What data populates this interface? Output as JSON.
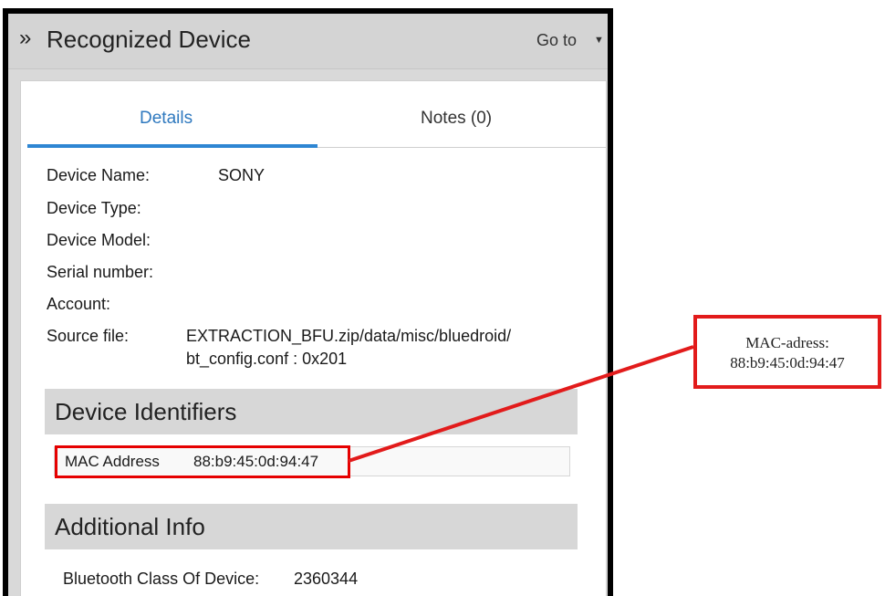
{
  "header": {
    "title": "Recognized Device",
    "goto_label": "Go to",
    "expand_icon": "double-chevron-right-icon",
    "dropdown_icon": "caret-down-icon"
  },
  "tabs": [
    {
      "label": "Details",
      "active": true
    },
    {
      "label": "Notes (0)",
      "active": false
    }
  ],
  "details": [
    {
      "label": "Device Name:",
      "value": "SONY"
    },
    {
      "label": "Device Type:",
      "value": ""
    },
    {
      "label": "Device Model:",
      "value": ""
    },
    {
      "label": "Serial number:",
      "value": ""
    },
    {
      "label": "Account:",
      "value": ""
    },
    {
      "label": "Source file:",
      "value": "EXTRACTION_BFU.zip/data/misc/bluedroid/",
      "value2": "bt_config.conf : 0x201"
    }
  ],
  "sections": {
    "identifiers_title": "Device Identifiers",
    "additional_title": "Additional Info"
  },
  "identifiers": {
    "mac_label": "MAC Address",
    "mac_value": "88:b9:45:0d:94:47"
  },
  "additional": {
    "bt_class_label": "Bluetooth Class Of Device:",
    "bt_class_value": "2360344"
  },
  "annotation": {
    "line1": "MAC-adress:",
    "line2": "88:b9:45:0d:94:47",
    "color": "#e21b1b"
  },
  "colors": {
    "active_tab": "#2f79bf",
    "tab_underline": "#2e86d3",
    "highlight": "#e60000"
  }
}
